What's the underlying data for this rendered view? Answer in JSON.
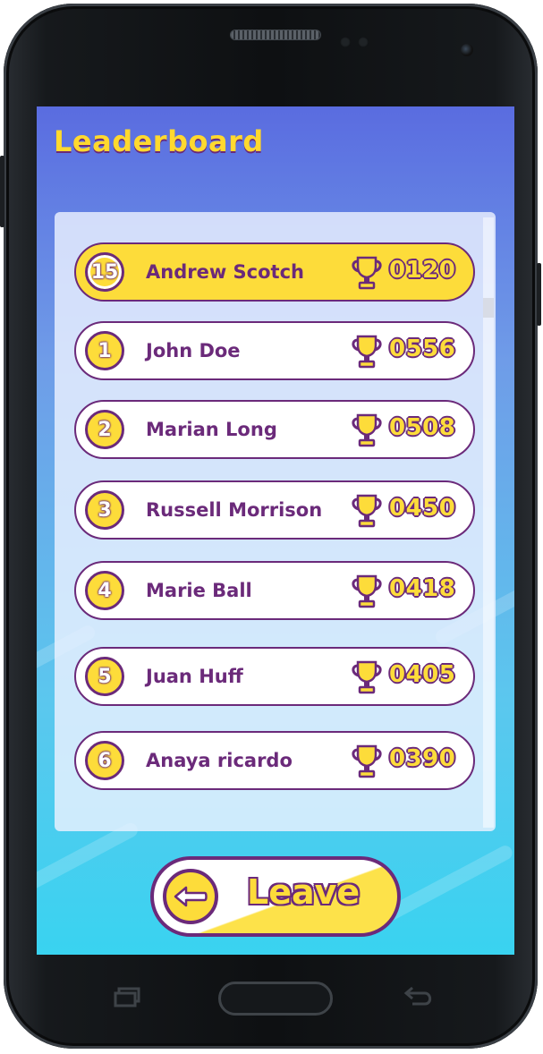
{
  "screen": {
    "title": "Leaderboard"
  },
  "current_player": {
    "rank": "15",
    "name": "Andrew Scotch",
    "score": "0120"
  },
  "leaderboard": [
    {
      "rank": "1",
      "name": "John Doe",
      "score": "0556"
    },
    {
      "rank": "2",
      "name": "Marian Long",
      "score": "0508"
    },
    {
      "rank": "3",
      "name": "Russell Morrison",
      "score": "0450"
    },
    {
      "rank": "4",
      "name": "Marie Ball",
      "score": "0418"
    },
    {
      "rank": "5",
      "name": "Juan Huff",
      "score": "0405"
    },
    {
      "rank": "6",
      "name": "Anaya ricardo",
      "score": "0390"
    }
  ],
  "actions": {
    "leave_label": "Leave"
  },
  "icons": {
    "trophy": "trophy-icon",
    "leave": "arrow-left-icon",
    "recents": "recent-apps-icon",
    "back": "back-icon"
  },
  "colors": {
    "accent_yellow": "#fddc3a",
    "accent_purple": "#6b2a7a",
    "background_top": "#5a6ce0",
    "background_bottom": "#39d3f0"
  }
}
